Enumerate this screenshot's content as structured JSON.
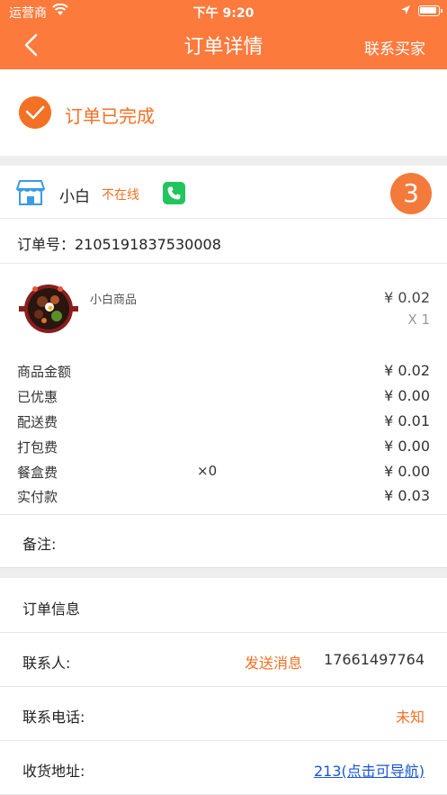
{
  "statusbar": {
    "carrier": "运营商",
    "time": "下午 9:20"
  },
  "nav": {
    "title": "订单详情",
    "right": "联系买家"
  },
  "order_status": {
    "text": "订单已完成"
  },
  "shop": {
    "name": "小白",
    "online_status": "不在线",
    "badge": "3"
  },
  "order": {
    "number_label": "订单号：2105191837530008"
  },
  "goods": {
    "name": "小白商品",
    "price": "¥ 0.02",
    "qty": "X 1"
  },
  "fees": [
    {
      "label": "商品金额",
      "extra": "",
      "value": "¥ 0.02"
    },
    {
      "label": "已优惠",
      "extra": "",
      "value": "¥ 0.00"
    },
    {
      "label": "配送费",
      "extra": "",
      "value": "¥ 0.01"
    },
    {
      "label": "打包费",
      "extra": "",
      "value": "¥ 0.00"
    },
    {
      "label": "餐盒费",
      "extra": "×0",
      "value": "¥ 0.00"
    },
    {
      "label": "实付款",
      "extra": "",
      "value": "¥ 0.03"
    }
  ],
  "remark": {
    "label": "备注:"
  },
  "info": {
    "title": "订单信息",
    "contact_label": "联系人:",
    "send_msg": "发送消息",
    "contact_phone": "17661497764",
    "tel_label": "联系电话:",
    "tel_value": "未知",
    "address_label": "收货地址:",
    "address_value": "213(点击可导航)"
  },
  "colors": {
    "header": "#fd7a3d",
    "accent": "#f47024",
    "link": "#1a56d6",
    "phone_icon": "#21c55e"
  }
}
